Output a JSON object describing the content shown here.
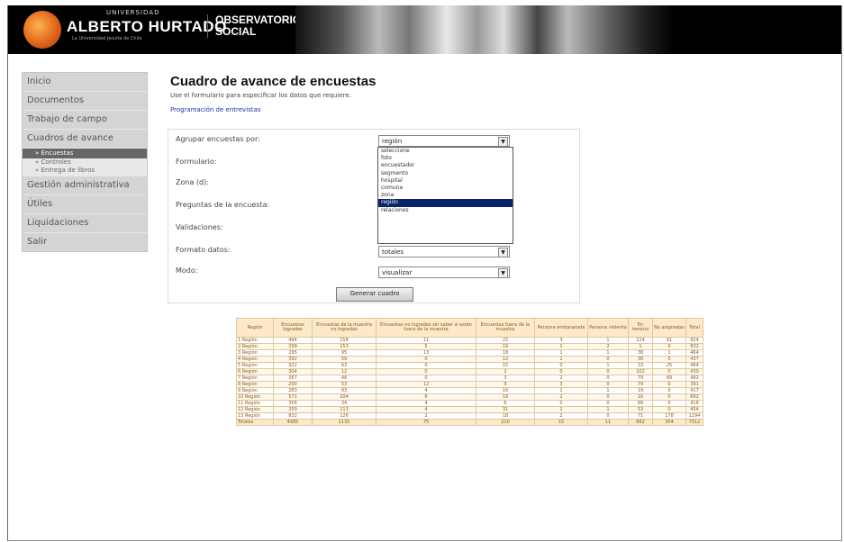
{
  "header": {
    "univ_small": "UNIVERSIDAD",
    "univ_name": "ALBERTO HURTADO",
    "univ_tagline": "La Universidad Jesuita de Chile",
    "obs_line1": "OBSERVATORIO",
    "obs_line2": "SOCIAL"
  },
  "sidebar": {
    "items_top": [
      "Inicio",
      "Documentos",
      "Trabajo de campo",
      "Cuadros de avance"
    ],
    "subitems": [
      "» Encuestas",
      "» Controles",
      "» Entrega de libros"
    ],
    "items_bottom": [
      "Gestión administrativa",
      "Útiles",
      "Liquidaciones",
      "Salir"
    ]
  },
  "main": {
    "title": "Cuadro de avance de encuestas",
    "instructions": "Use el formulario para especificar los datos que requiere.",
    "link": "Programación de entrevistas"
  },
  "form": {
    "rows": [
      {
        "label": "Agrupar encuestas por:",
        "value": "región"
      },
      {
        "label": "Formulario:",
        "value": ""
      },
      {
        "label": "Zona (d):",
        "value": ""
      },
      {
        "label": "Preguntas de la encuesta:",
        "value": ""
      },
      {
        "label": "Validaciones:",
        "value": ""
      },
      {
        "label": "Formato datos:",
        "value": "totales"
      },
      {
        "label": "Modo:",
        "value": "visualizar"
      }
    ],
    "dropdown_options": [
      "seleccione",
      "foto",
      "encuestador",
      "segmento",
      "hospital",
      "comuna",
      "zona",
      "región",
      "relaciones"
    ],
    "dropdown_selected_index": 7,
    "button_label": "Generar cuadro"
  },
  "table": {
    "headers": [
      "Región",
      "Encuestas logradas",
      "Encuestas de la muestra no logradas",
      "Encuestas no logradas sin saber si están fuera de la muestra",
      "Encuestas fuera de la muestra",
      "Persona embarazada",
      "Persona violenta",
      "En terreno",
      "No asignadas",
      "Total"
    ],
    "rows": [
      [
        "1 Región",
        "494",
        "158",
        "11",
        "22",
        "3",
        "1",
        "124",
        "91",
        "924"
      ],
      [
        "2 Región",
        "299",
        "153",
        "5",
        "19",
        "1",
        "2",
        "1",
        "0",
        "832"
      ],
      [
        "3 Región",
        "295",
        "95",
        "13",
        "18",
        "1",
        "1",
        "38",
        "1",
        "464"
      ],
      [
        "4 Región",
        "392",
        "59",
        "0",
        "12",
        "1",
        "0",
        "38",
        "0",
        "437"
      ],
      [
        "5 Región",
        "322",
        "63",
        "0",
        "15",
        "0",
        "1",
        "33",
        "25",
        "464"
      ],
      [
        "6 Región",
        "304",
        "12",
        "0",
        "2",
        "0",
        "0",
        "102",
        "0",
        "430"
      ],
      [
        "7 Región",
        "267",
        "48",
        "0",
        "3",
        "2",
        "0",
        "79",
        "89",
        "482"
      ],
      [
        "8 Región",
        "290",
        "53",
        "12",
        "9",
        "3",
        "0",
        "79",
        "0",
        "391"
      ],
      [
        "9 Región",
        "283",
        "93",
        "4",
        "16",
        "1",
        "1",
        "19",
        "0",
        "417"
      ],
      [
        "10 Región",
        "571",
        "204",
        "6",
        "19",
        "2",
        "0",
        "16",
        "0",
        "892"
      ],
      [
        "11 Región",
        "356",
        "34",
        "4",
        "6",
        "0",
        "0",
        "68",
        "0",
        "418"
      ],
      [
        "12 Región",
        "250",
        "113",
        "4",
        "31",
        "1",
        "1",
        "53",
        "0",
        "454"
      ],
      [
        "13 Región",
        "832",
        "126",
        "2",
        "18",
        "2",
        "0",
        "71",
        "178",
        "1294"
      ],
      [
        "Totales",
        "4985",
        "1135",
        "75",
        "210",
        "15",
        "11",
        "662",
        "304",
        "7312"
      ]
    ]
  }
}
